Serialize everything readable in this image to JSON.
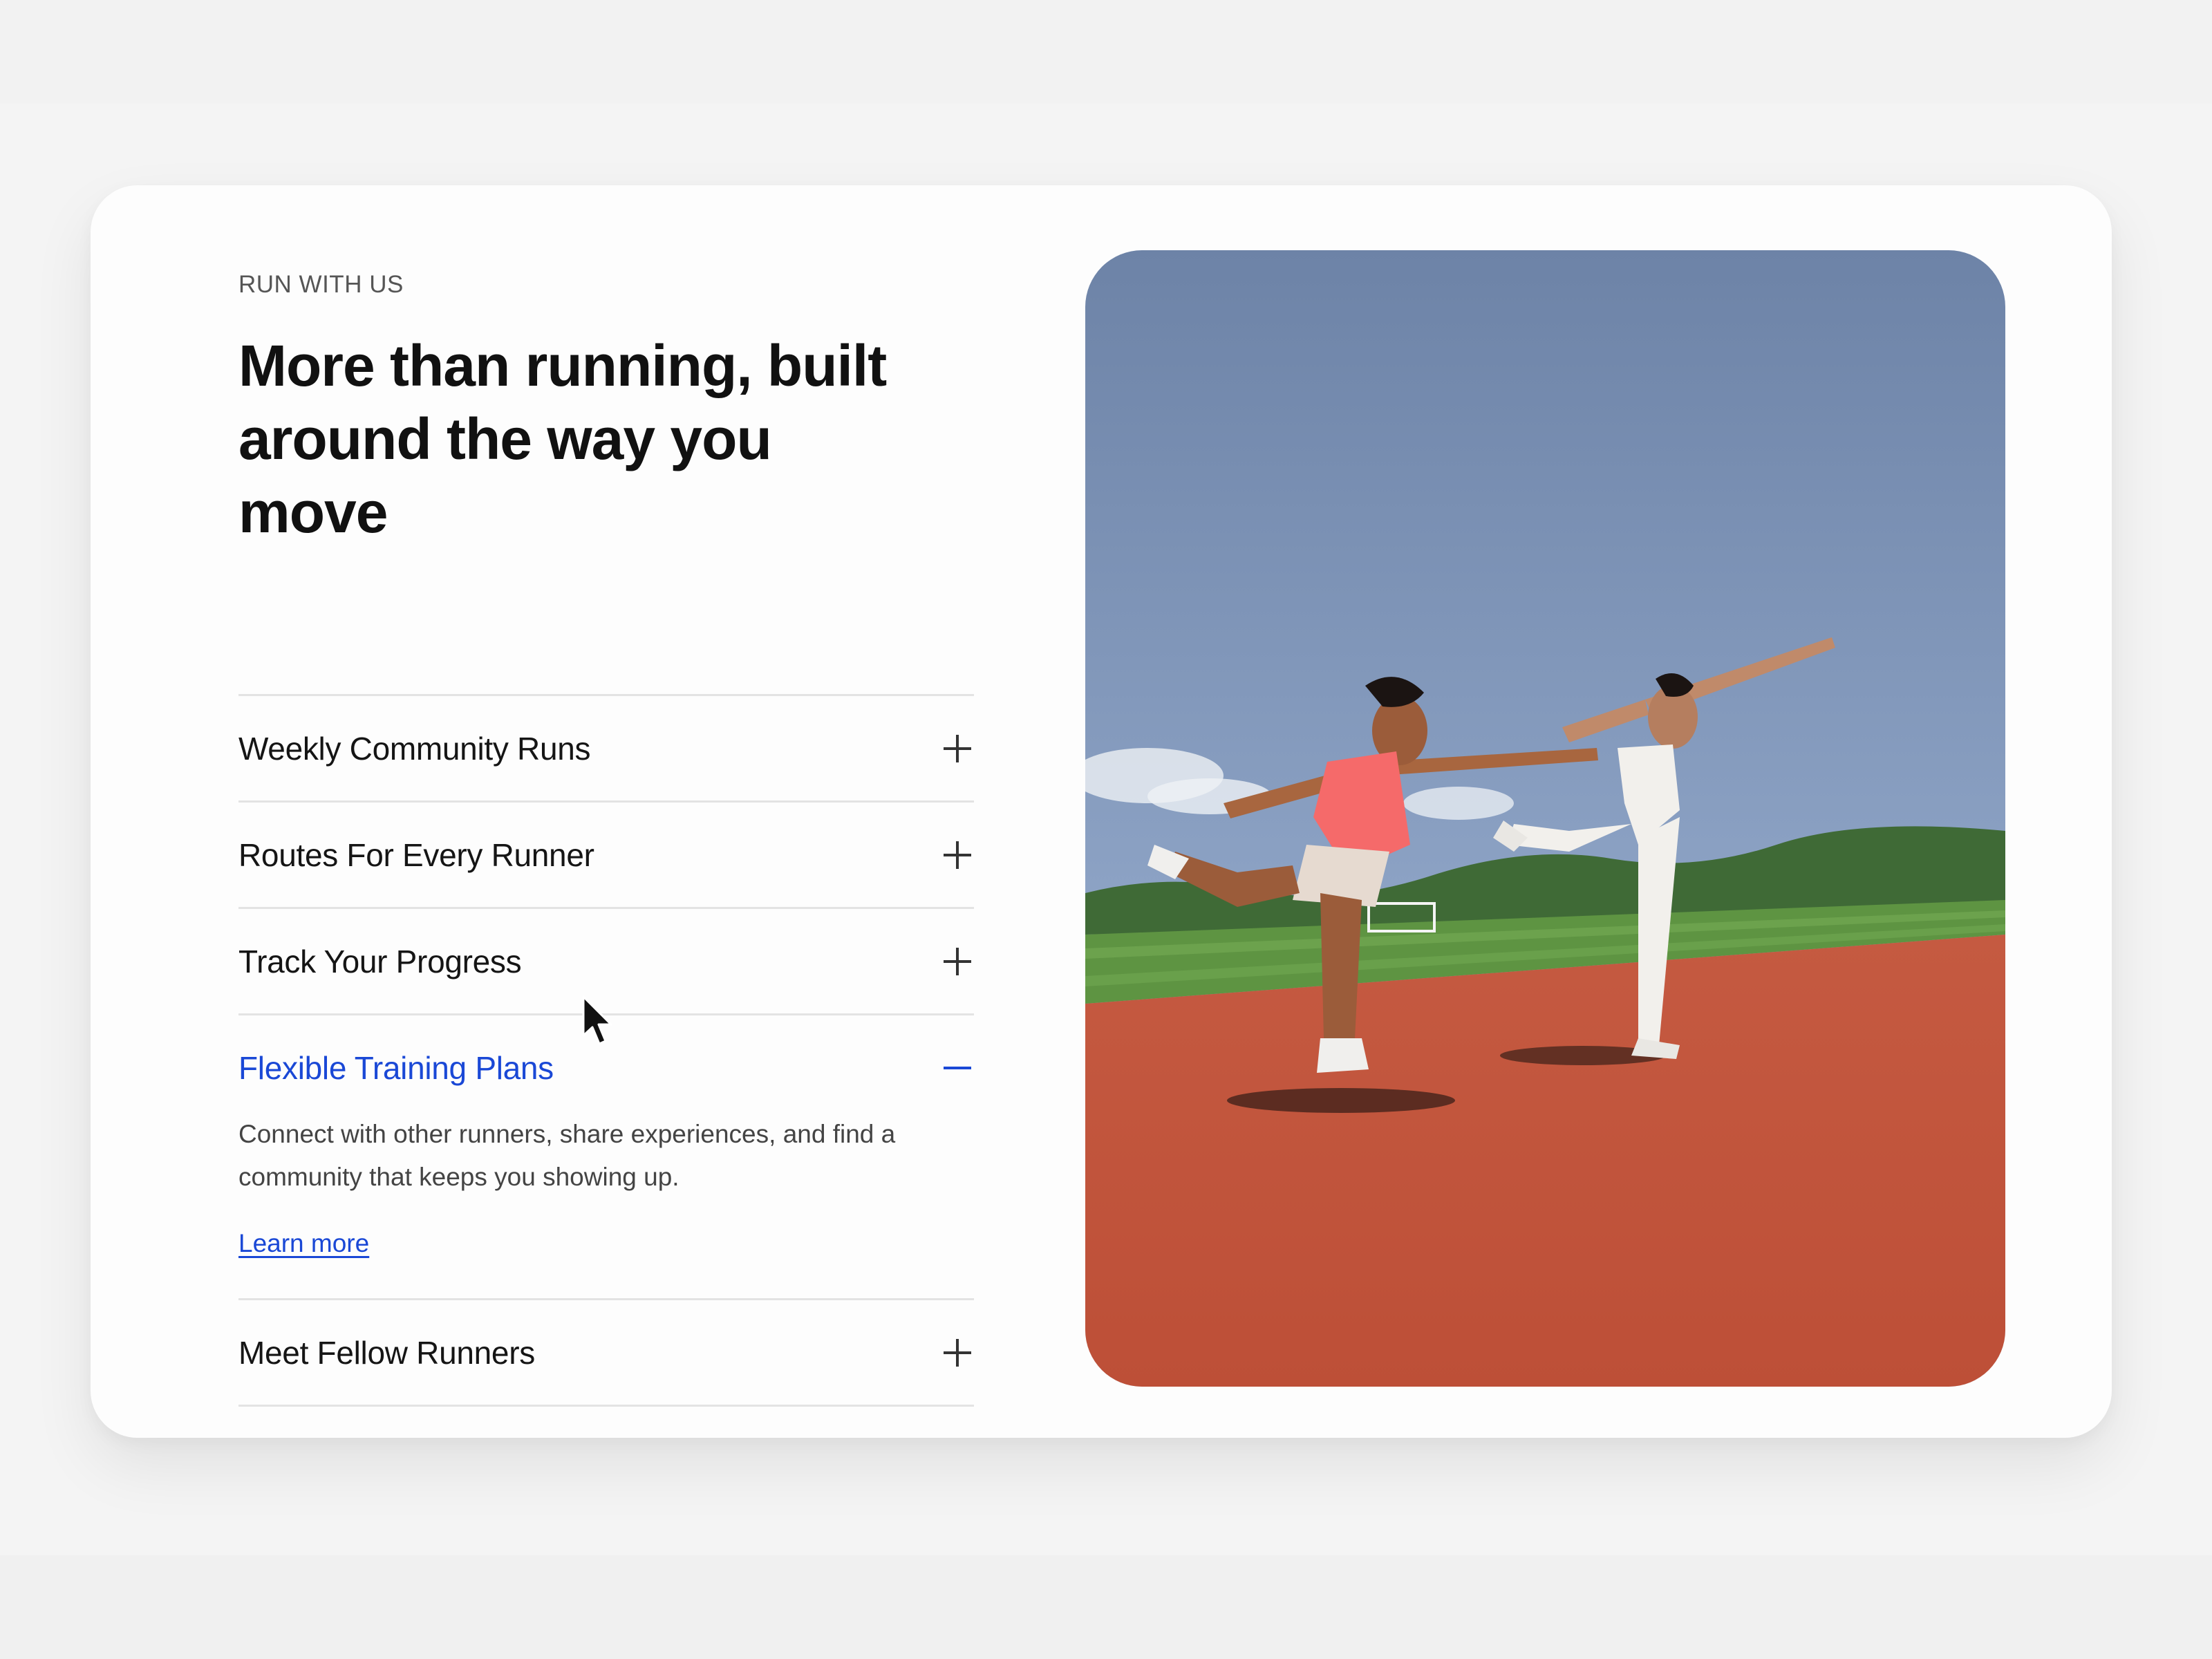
{
  "section": {
    "eyebrow": "RUN WITH US",
    "headline": "More than running, built around the way you move"
  },
  "accordion": {
    "items": [
      {
        "label": "Weekly Community Runs",
        "expanded": false,
        "icon": "plus-icon"
      },
      {
        "label": "Routes For Every Runner",
        "expanded": false,
        "icon": "plus-icon"
      },
      {
        "label": "Track Your Progress",
        "expanded": false,
        "icon": "plus-icon"
      },
      {
        "label": "Flexible Training Plans",
        "expanded": true,
        "icon": "minus-icon",
        "body": "Connect with other runners, share experiences, and find a community that keeps you showing up.",
        "link": "Learn more"
      },
      {
        "label": "Meet Fellow Runners",
        "expanded": false,
        "icon": "plus-icon"
      }
    ]
  },
  "image": {
    "description_icon": "athletes-photo",
    "colors": {
      "sky": "#7f95b7",
      "grass": "#4f8a38",
      "track": "#c85a3f"
    }
  },
  "colors": {
    "accent": "#1a48d6",
    "text": "#111111",
    "divider": "#e3e3e3",
    "page_bg": "#f4f4f4",
    "card_bg": "#fdfdfd"
  }
}
